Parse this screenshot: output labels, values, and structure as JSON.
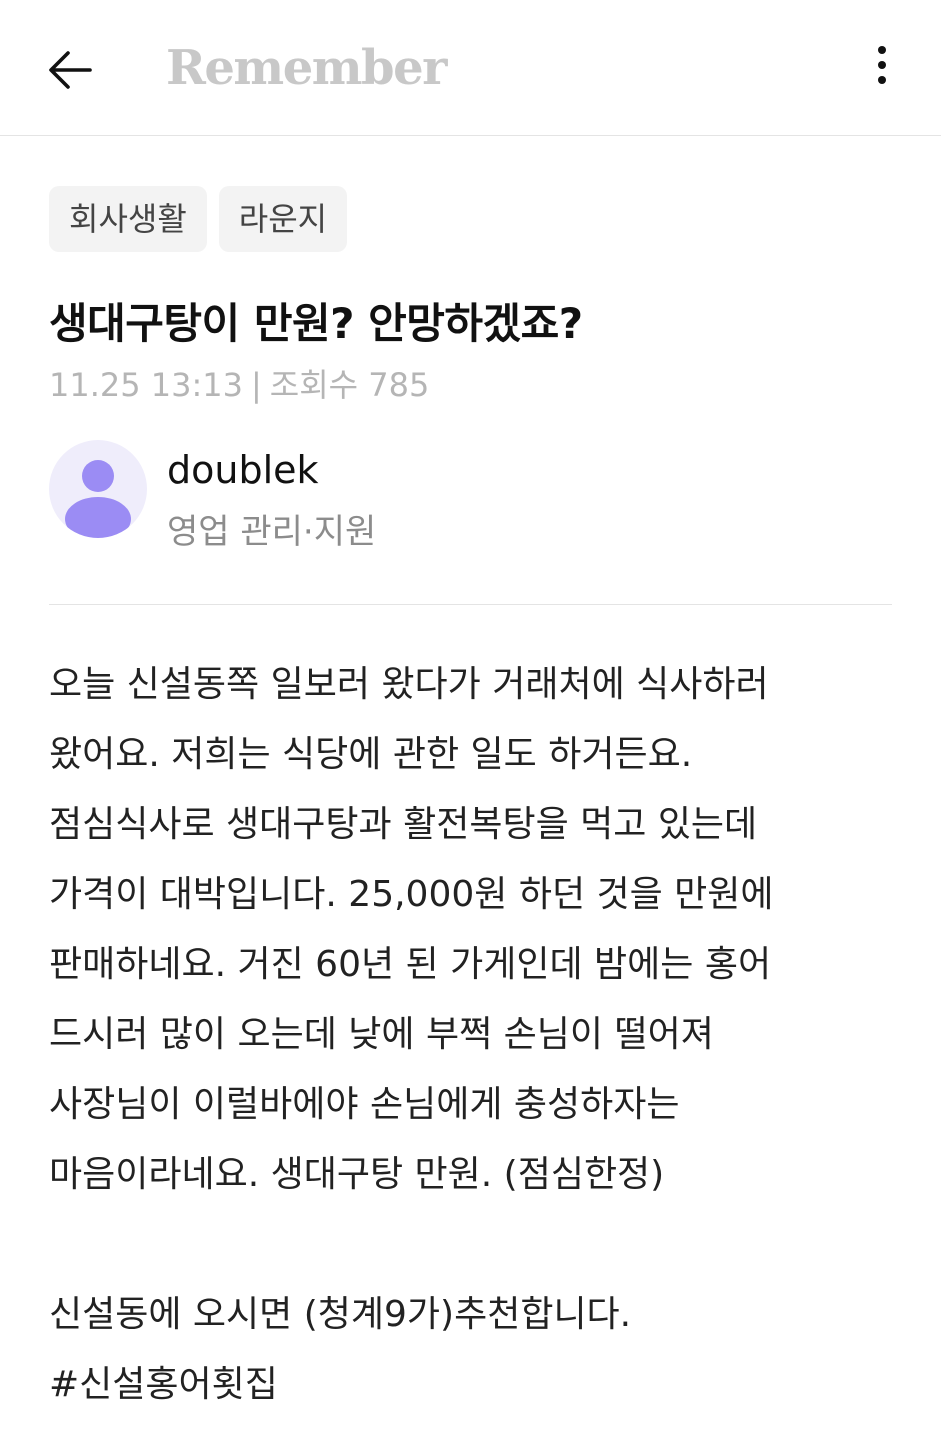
{
  "header": {
    "logo": "Remember",
    "back_icon": "arrow-left-icon",
    "more_icon": "more-vertical-icon"
  },
  "tags": [
    "회사생활",
    "라운지"
  ],
  "post": {
    "title": "생대구탕이 만원? 안망하겠죠?",
    "date": "11.25 13:13",
    "separator": "|",
    "views_label": "조회수",
    "views": "785"
  },
  "author": {
    "name": "doublek",
    "department": "영업 관리·지원"
  },
  "body": {
    "paragraph1": [
      "오늘 신설동쪽 일보러 왔다가 거래처에 식사하러",
      "왔어요. 저희는 식당에 관한 일도 하거든요.",
      "점심식사로 생대구탕과 활전복탕을 먹고 있는데",
      "가격이 대박입니다. 25,000원 하던 것을 만원에",
      "판매하네요. 거진 60년 된 가게인데 밤에는 홍어",
      "드시러 많이 오는데 낮에 부쩍 손님이 떨어져",
      "사장님이 이럴바에야 손님에게 충성하자는",
      "마음이라네요. 생대구탕 만원. (점심한정)"
    ],
    "paragraph2": [
      "신설동에 오시면 (청계9가)추천합니다.",
      "#신설홍어횟집"
    ]
  },
  "colors": {
    "avatar_bg": "#efedfb",
    "avatar_fg": "#9b8cf4",
    "logo": "#c8c8c8"
  }
}
